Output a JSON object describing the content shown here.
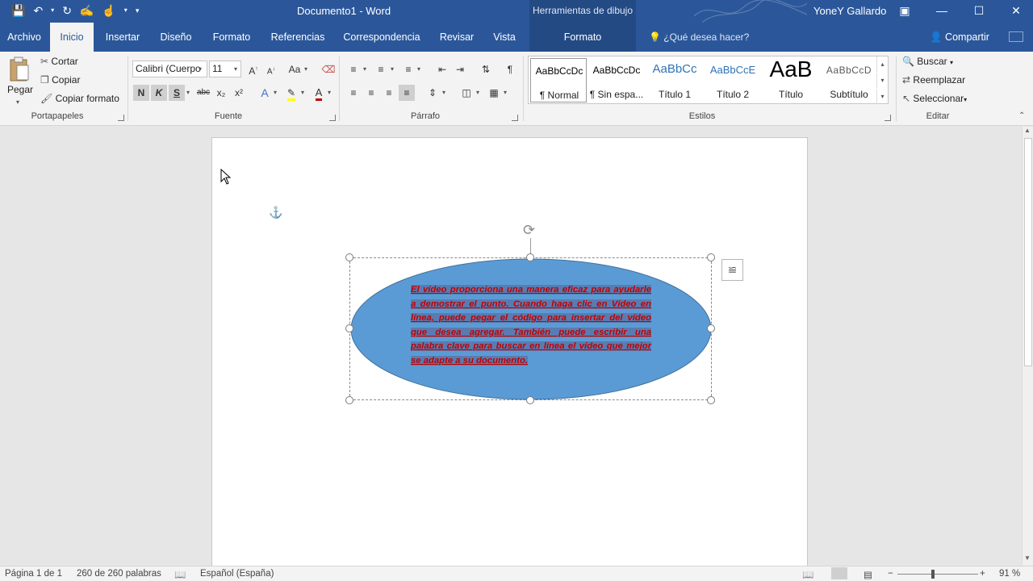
{
  "titlebar": {
    "doc_title": "Documento1 - Word",
    "context_header": "Herramientas de dibujo",
    "user": "YoneY Gallardo"
  },
  "tabs": [
    {
      "label": "Archivo"
    },
    {
      "label": "Inicio"
    },
    {
      "label": "Insertar"
    },
    {
      "label": "Diseño"
    },
    {
      "label": "Formato"
    },
    {
      "label": "Referencias"
    },
    {
      "label": "Correspondencia"
    },
    {
      "label": "Revisar"
    },
    {
      "label": "Vista"
    },
    {
      "label": "Formato"
    }
  ],
  "tell_me": "¿Qué desea hacer?",
  "share": "Compartir",
  "clipboard": {
    "paste": "Pegar",
    "cut": "Cortar",
    "copy": "Copiar",
    "format_painter": "Copiar formato",
    "label": "Portapapeles"
  },
  "font": {
    "name": "Calibri (Cuerpo",
    "size": "11",
    "label": "Fuente",
    "bold": "N",
    "italic": "K",
    "underline": "S",
    "strike": "abc",
    "subscript": "x₂",
    "superscript": "x²",
    "case": "Aa"
  },
  "paragraph": {
    "label": "Párrafo"
  },
  "styles": {
    "label": "Estilos",
    "items": [
      {
        "preview": "AaBbCcDc",
        "name": "¶ Normal"
      },
      {
        "preview": "AaBbCcDc",
        "name": "¶ Sin espa..."
      },
      {
        "preview": "AaBbCc",
        "name": "Título 1"
      },
      {
        "preview": "AaBbCcE",
        "name": "Título 2"
      },
      {
        "preview": "AaB",
        "name": "Título"
      },
      {
        "preview": "AaBbCcD",
        "name": "Subtítulo"
      }
    ]
  },
  "editing": {
    "label": "Editar",
    "find": "Buscar",
    "replace": "Reemplazar",
    "select": "Seleccionar"
  },
  "shape": {
    "text": "El vídeo proporciona una manera eficaz para ayudarle a demostrar el punto. Cuando haga clic en Vídeo en línea, puede pegar el código para insertar del vídeo que desea agregar. También puede escribir una palabra clave para buscar en línea el vídeo que mejor se adapte a su documento."
  },
  "status": {
    "page": "Página 1 de 1",
    "words": "260 de 260 palabras",
    "language": "Español (España)",
    "zoom": "91 %"
  }
}
